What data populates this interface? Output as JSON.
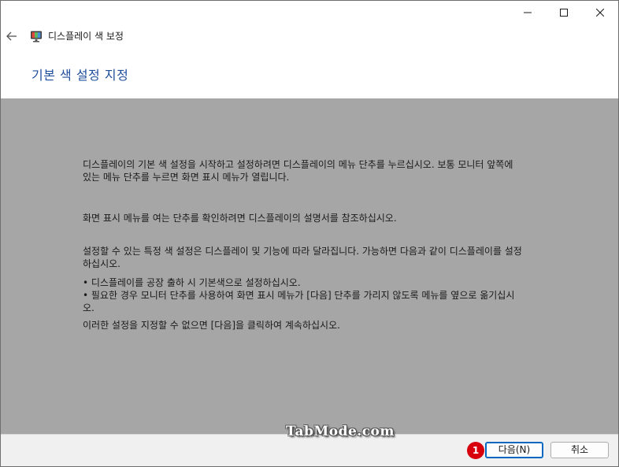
{
  "window": {
    "title": "디스플레이 색 보정",
    "page_title": "기본 색 설정 지정",
    "icons": {
      "back": "back-arrow-icon",
      "app": "display-monitor-icon",
      "minimize": "minimize-icon",
      "maximize": "maximize-icon",
      "close": "close-icon"
    }
  },
  "content": {
    "background": "#a6a6a6",
    "paragraphs": {
      "p1": "디스플레이의 기본 색 설정을 시작하고 설정하려면 디스플레이의 메뉴 단추를 누르십시오. 보통 모니터 앞쪽에 있는 메뉴 단추를 누르면 화면 표시 메뉴가 열립니다.",
      "p2": "화면 표시 메뉴를 여는 단추를 확인하려면 디스플레이의 설명서를 참조하십시오.",
      "p3": "설정할 수 있는 특정 색 설정은 디스플레이 및 기능에 따라 달라집니다. 가능하면 다음과 같이 디스플레이를 설정하십시오.",
      "b1": "• 디스플레이를 공장 출하 시 기본색으로 설정하십시오.",
      "b2": "• 필요한 경우 모니터 단추를 사용하여 화면 표시 메뉴가 [다음] 단추를 가리지 않도록 메뉴를 옆으로 옮기십시오.",
      "p4": "이러한 설정을 지정할 수 없으면 [다음]을 클릭하여 계속하십시오."
    }
  },
  "footer": {
    "next_label": "다음(N)",
    "cancel_label": "취소",
    "badge": "1",
    "watermark": "TabMode.com"
  },
  "colors": {
    "title_blue": "#1f4e9c",
    "accent": "#0067c0",
    "badge_red": "#d8000c"
  }
}
